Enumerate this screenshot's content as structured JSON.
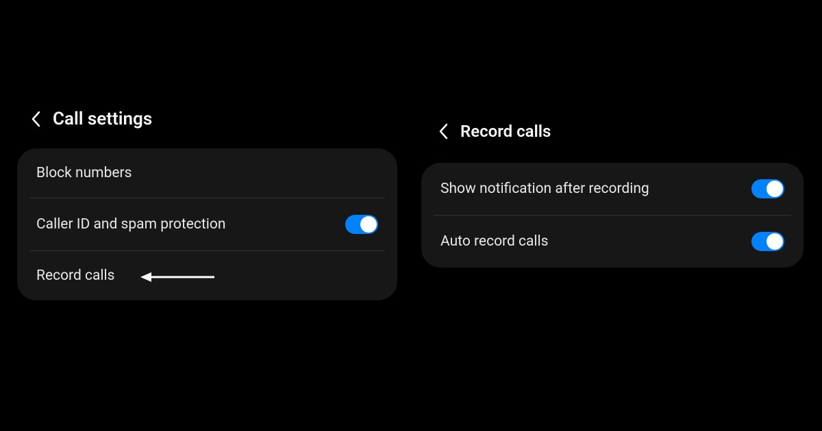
{
  "left_panel": {
    "title": "Call settings",
    "items": [
      {
        "label": "Block numbers",
        "has_toggle": false
      },
      {
        "label": "Caller ID and spam protection",
        "has_toggle": true,
        "toggled": true
      },
      {
        "label": "Record calls",
        "has_toggle": false
      }
    ]
  },
  "right_panel": {
    "title": "Record calls",
    "items": [
      {
        "label": "Show notification after recording",
        "has_toggle": true,
        "toggled": true
      },
      {
        "label": "Auto record calls",
        "has_toggle": true,
        "toggled": true
      }
    ]
  },
  "colors": {
    "accent": "#0381fe",
    "card_bg": "#171717",
    "text": "#e8e8e8",
    "divider": "#333333"
  }
}
